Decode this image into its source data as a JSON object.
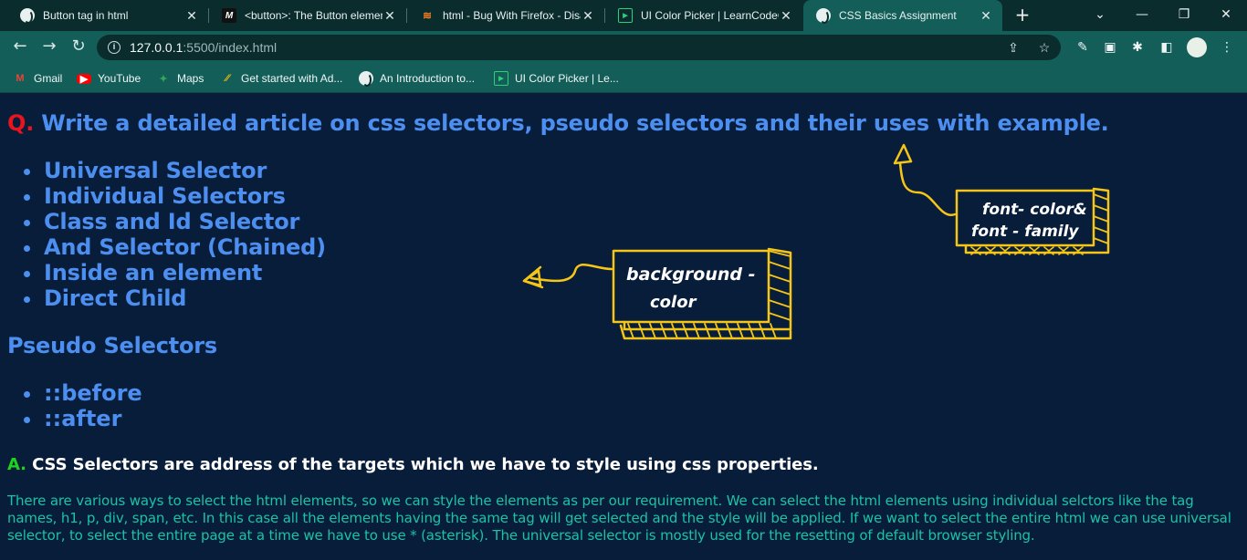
{
  "browser": {
    "tabs": [
      {
        "title": "Button tag in html",
        "favicon": "globe-icon",
        "active": false
      },
      {
        "title": "<button>: The Button element",
        "favicon": "mdn-icon",
        "active": false
      },
      {
        "title": "html - Bug With Firefox - Disable",
        "favicon": "stackoverflow-icon",
        "active": false
      },
      {
        "title": "UI Color Picker | LearnCodeOnline",
        "favicon": "learncodeonline-icon",
        "active": false
      },
      {
        "title": "CSS Basics Assignment",
        "favicon": "globe-icon",
        "active": true
      }
    ],
    "new_tab_label": "+",
    "address": {
      "host": "127.0.0.1",
      "path": ":5500/index.html"
    },
    "bookmarks": [
      {
        "label": "Gmail",
        "icon": "gmail-icon"
      },
      {
        "label": "YouTube",
        "icon": "youtube-icon"
      },
      {
        "label": "Maps",
        "icon": "maps-icon"
      },
      {
        "label": "Get started with Ad...",
        "icon": "google-ads-icon"
      },
      {
        "label": "An Introduction to...",
        "icon": "globe-icon"
      },
      {
        "label": "UI Color Picker | Le...",
        "icon": "learncodeonline-icon"
      }
    ]
  },
  "page": {
    "question_mark": "Q.",
    "question_text": " Write a detailed article on css selectors, pseudo selectors and their uses with example.",
    "selectors": [
      "Universal Selector",
      "Individual Selectors",
      "Class and Id Selector",
      "And Selector (Chained)",
      "Inside an element",
      "Direct Child"
    ],
    "pseudo_heading": "Pseudo Selectors",
    "pseudo_selectors": [
      "::before",
      "::after"
    ],
    "answer_mark": "A.",
    "answer_text": " CSS Selectors are address of the targets which we have to style using css properties.",
    "paragraph": "There are various ways to select the html elements, so we can style the elements as per our requirement. We can select the html elements using individual selctors like the tag names, h1, p, div, span, etc. In this case all the elements having the same tag will get selected and the style will be applied. If we want to select the entire html we can use universal selector, to select the entire page at a time we have to use * (asterisk). The universal selector is mostly used for the resetting of default browser styling.",
    "annotations": {
      "background_line1": "background -",
      "background_line2": "color",
      "font_line1": "font- color&",
      "font_line2": "font - family"
    }
  },
  "colors": {
    "page_bg": "#071d3a",
    "heading_blue": "#4d8ff0",
    "question_red": "#e8141e",
    "answer_green": "#1ed31e",
    "paragraph_teal": "#1ac3a6",
    "sketch_yellow": "#f5c518",
    "chrome_dark": "#0a2c2c",
    "chrome_teal": "#145e5a"
  }
}
